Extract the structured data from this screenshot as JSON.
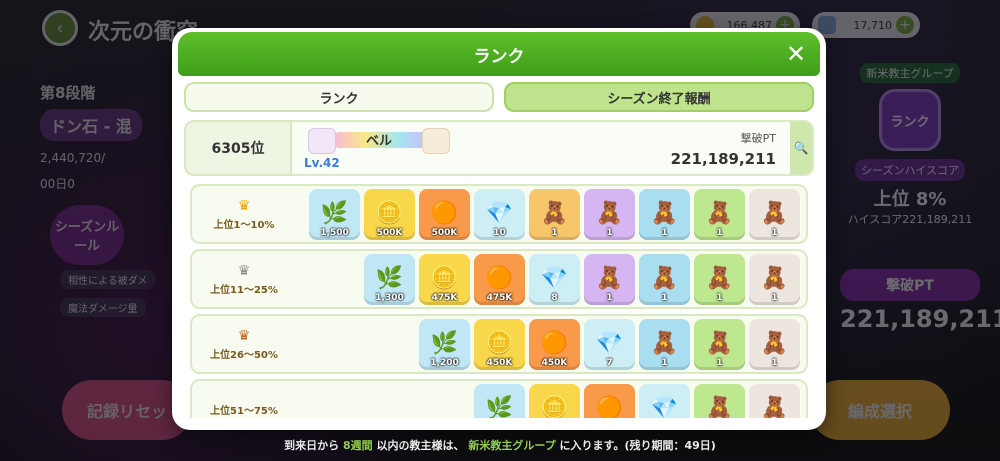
{
  "background": {
    "stage_title": "次元の衝突",
    "currency_coin": "166,487",
    "currency_crystal": "17,710",
    "phase_label": "第8段階",
    "stone_label": "ドン石 - 混",
    "hp_value": "2,440,720/",
    "timer": "00日0",
    "season_rule": "シーズンルール",
    "bullet_1": "相性による被ダメ",
    "bullet_2": "魔法ダメージ量",
    "record_button": "記録リセッ",
    "formation_button": "編成選択",
    "group_label": "新米教主グループ",
    "rank_button": "ランク",
    "highscore_badge": "シーズンハイスコア",
    "highscore_rank": "上位 8%",
    "highscore_score": "ハイスコア221,189,211",
    "pt_badge": "撃破PT",
    "pt_value": "221,189,211"
  },
  "footer": {
    "prefix": "到来日から",
    "weeks": "8週間",
    "middle": "以内の教主様は、",
    "group": "新米教主グループ",
    "suffix": "に入ります。(残り期間：49日)"
  },
  "modal": {
    "title": "ランク",
    "tabs": [
      {
        "label": "ランク",
        "active": true
      },
      {
        "label": "シーズン終了報酬",
        "active": false
      }
    ],
    "my_rank": "6305位",
    "player_name": "ベル",
    "player_level": "Lv.42",
    "pt_label": "撃破PT",
    "pt_value": "221,189,211"
  },
  "tiers": [
    {
      "label": "上位1～10%",
      "crown_icon": "gold-crown-icon",
      "items": [
        {
          "icon": "seed-icon",
          "count": "1,500"
        },
        {
          "icon": "coin-icon",
          "count": "500K"
        },
        {
          "icon": "macaron-icon",
          "count": "500K"
        },
        {
          "icon": "crystal-icon",
          "count": "10"
        },
        {
          "icon": "character-icon",
          "count": "1"
        },
        {
          "icon": "character-icon",
          "count": "1"
        },
        {
          "icon": "character-icon",
          "count": "1"
        },
        {
          "icon": "character-icon",
          "count": "1"
        },
        {
          "icon": "character-icon",
          "count": "1"
        }
      ]
    },
    {
      "label": "上位11～25%",
      "crown_icon": "silver-crown-icon",
      "items": [
        {
          "icon": "seed-icon",
          "count": "1,300"
        },
        {
          "icon": "coin-icon",
          "count": "475K"
        },
        {
          "icon": "macaron-icon",
          "count": "475K"
        },
        {
          "icon": "crystal-icon",
          "count": "8"
        },
        {
          "icon": "character-icon",
          "count": "1"
        },
        {
          "icon": "character-icon",
          "count": "1"
        },
        {
          "icon": "character-icon",
          "count": "1"
        },
        {
          "icon": "character-icon",
          "count": "1"
        }
      ]
    },
    {
      "label": "上位26～50%",
      "crown_icon": "bronze-crown-icon",
      "items": [
        {
          "icon": "seed-icon",
          "count": "1,200"
        },
        {
          "icon": "coin-icon",
          "count": "450K"
        },
        {
          "icon": "macaron-icon",
          "count": "450K"
        },
        {
          "icon": "crystal-icon",
          "count": "7"
        },
        {
          "icon": "character-icon",
          "count": "1"
        },
        {
          "icon": "character-icon",
          "count": "1"
        },
        {
          "icon": "character-icon",
          "count": "1"
        }
      ]
    },
    {
      "label": "上位51～75%",
      "crown_icon": "",
      "items": [
        {
          "icon": "seed-icon",
          "count": ""
        },
        {
          "icon": "coin-icon",
          "count": ""
        },
        {
          "icon": "macaron-icon",
          "count": ""
        },
        {
          "icon": "crystal-icon",
          "count": ""
        },
        {
          "icon": "character-icon",
          "count": ""
        },
        {
          "icon": "character-icon",
          "count": ""
        }
      ]
    }
  ]
}
